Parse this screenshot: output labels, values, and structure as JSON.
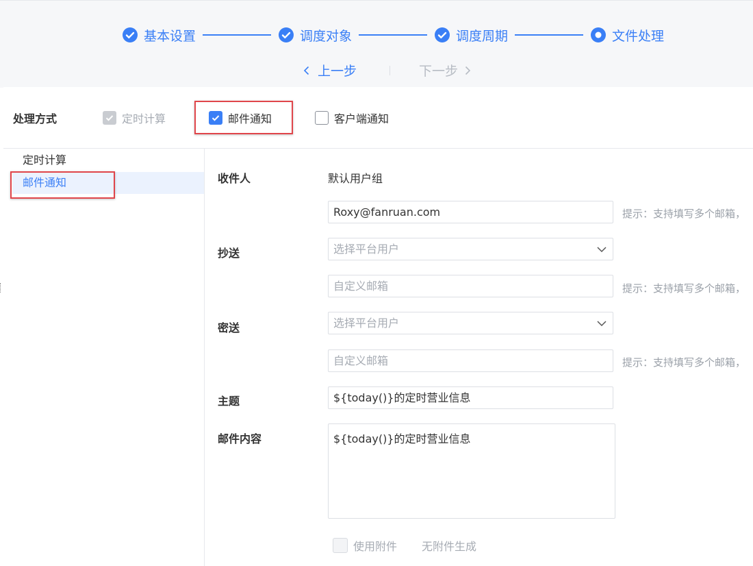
{
  "steps": [
    {
      "label": "基本设置",
      "state": "done"
    },
    {
      "label": "调度对象",
      "state": "done"
    },
    {
      "label": "调度周期",
      "state": "done"
    },
    {
      "label": "文件处理",
      "state": "current"
    }
  ],
  "nav": {
    "prev": "上一步",
    "next": "下一步"
  },
  "mode": {
    "title": "处理方式",
    "options": [
      {
        "label": "定时计算",
        "checked": true,
        "disabled": true
      },
      {
        "label": "邮件通知",
        "checked": true,
        "disabled": false
      },
      {
        "label": "客户端通知",
        "checked": false,
        "disabled": false
      }
    ]
  },
  "sidebar": {
    "items": [
      {
        "label": "定时计算"
      },
      {
        "label": "邮件通知",
        "active": true
      }
    ]
  },
  "form": {
    "recipient_label": "收件人",
    "recipient_value": "默认用户组",
    "recipient_email": "Roxy@fanruan.com",
    "hint": "提示：支持填写多个邮箱，",
    "cc_label": "抄送",
    "cc_select_placeholder": "选择平台用户",
    "cc_email_placeholder": "自定义邮箱",
    "bcc_label": "密送",
    "bcc_select_placeholder": "选择平台用户",
    "bcc_email_placeholder": "自定义邮箱",
    "subject_label": "主题",
    "subject_value": "${today()}的定时营业信息",
    "content_label": "邮件内容",
    "content_value": "${today()}的定时营业信息",
    "attach_label": "使用附件",
    "attach_none": "无附件生成"
  },
  "colors": {
    "accent": "#3a7ff6",
    "highlight": "#e0454a"
  }
}
